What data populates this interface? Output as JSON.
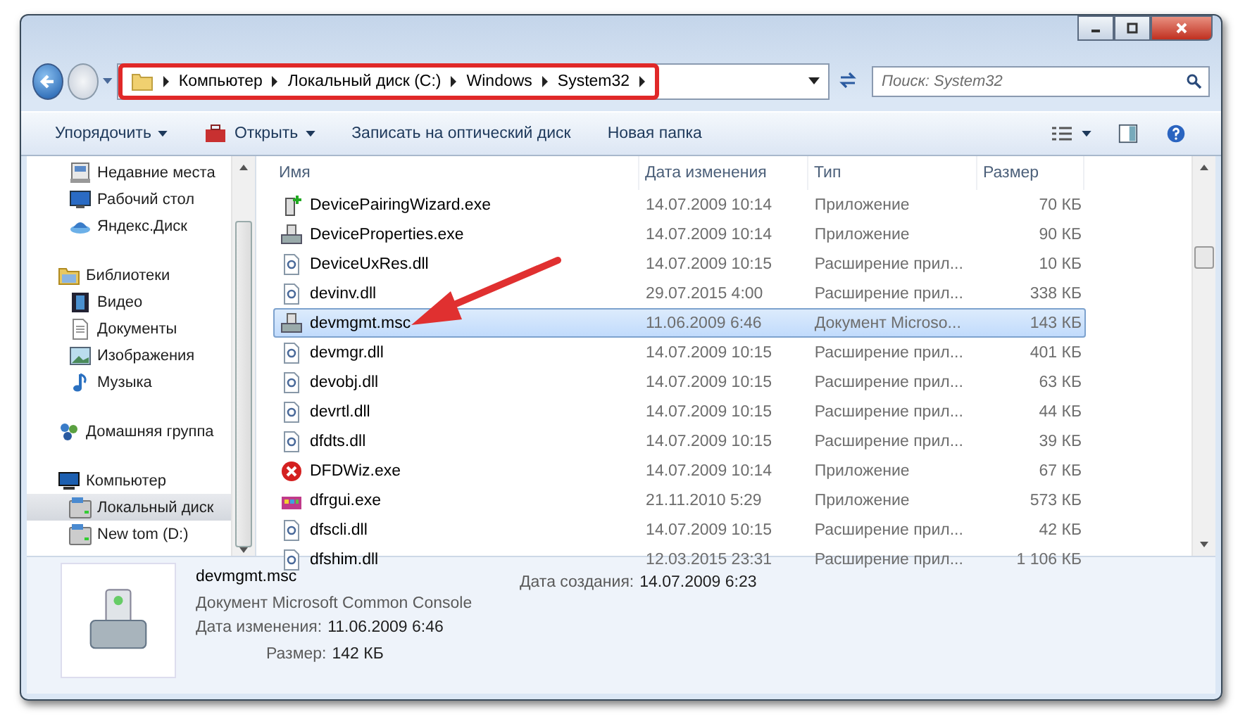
{
  "address_bar": {
    "crumbs": [
      "Компьютер",
      "Локальный диск (C:)",
      "Windows",
      "System32"
    ],
    "highlighted": true
  },
  "search": {
    "placeholder": "Поиск: System32"
  },
  "toolbar": {
    "buttons": [
      {
        "kind": "menu",
        "label": "Упорядочить"
      },
      {
        "kind": "open",
        "label": "Открыть"
      },
      {
        "kind": "plain",
        "label": "Записать на оптический диск"
      },
      {
        "kind": "plain",
        "label": "Новая папка"
      }
    ]
  },
  "sidebar": {
    "favorites": [
      {
        "kind": "recent",
        "label": "Недавние места",
        "selected": false
      },
      {
        "kind": "desktop",
        "label": "Рабочий стол",
        "selected": false
      },
      {
        "kind": "cloud",
        "label": "Яндекс.Диск",
        "selected": false
      }
    ],
    "tree": [
      {
        "kind": "library",
        "label": "Библиотеки",
        "selected": false,
        "children": [
          {
            "kind": "video",
            "label": "Видео",
            "selected": false
          },
          {
            "kind": "document",
            "label": "Документы",
            "selected": false
          },
          {
            "kind": "image",
            "label": "Изображения",
            "selected": false
          },
          {
            "kind": "music",
            "label": "Музыка",
            "selected": false
          }
        ]
      },
      {
        "kind": "homegroup",
        "label": "Домашняя группа",
        "selected": false
      },
      {
        "kind": "computer",
        "label": "Компьютер",
        "selected": false,
        "children": [
          {
            "kind": "drive",
            "label": "Локальный диск",
            "selected": true
          },
          {
            "kind": "drive",
            "label": "New tom (D:)",
            "selected": false
          }
        ]
      }
    ]
  },
  "table": {
    "columns": [
      "Имя",
      "Дата изменения",
      "Тип",
      "Размер"
    ],
    "rows": [
      {
        "kind": "wizard",
        "name": "DevicePairingWizard.exe",
        "date": "14.07.2009 10:14",
        "type": "Приложение",
        "size": "70 КБ",
        "selected": false
      },
      {
        "kind": "device",
        "name": "DeviceProperties.exe",
        "date": "14.07.2009 10:14",
        "type": "Приложение",
        "size": "90 КБ",
        "selected": false
      },
      {
        "kind": "dll",
        "name": "DeviceUxRes.dll",
        "date": "14.07.2009 10:15",
        "type": "Расширение прил...",
        "size": "10 КБ",
        "selected": false
      },
      {
        "kind": "dll",
        "name": "devinv.dll",
        "date": "29.07.2015 4:00",
        "type": "Расширение прил...",
        "size": "338 КБ",
        "selected": false
      },
      {
        "kind": "device",
        "name": "devmgmt.msc",
        "date": "11.06.2009 6:46",
        "type": "Документ Microso...",
        "size": "143 КБ",
        "selected": true
      },
      {
        "kind": "dll",
        "name": "devmgr.dll",
        "date": "14.07.2009 10:15",
        "type": "Расширение прил...",
        "size": "401 КБ",
        "selected": false
      },
      {
        "kind": "dll",
        "name": "devobj.dll",
        "date": "14.07.2009 10:15",
        "type": "Расширение прил...",
        "size": "63 КБ",
        "selected": false
      },
      {
        "kind": "dll",
        "name": "devrtl.dll",
        "date": "14.07.2009 10:15",
        "type": "Расширение прил...",
        "size": "44 КБ",
        "selected": false
      },
      {
        "kind": "dll",
        "name": "dfdts.dll",
        "date": "14.07.2009 10:15",
        "type": "Расширение прил...",
        "size": "39 КБ",
        "selected": false
      },
      {
        "kind": "error",
        "name": "DFDWiz.exe",
        "date": "14.07.2009 10:14",
        "type": "Приложение",
        "size": "67 КБ",
        "selected": false
      },
      {
        "kind": "defrag",
        "name": "dfrgui.exe",
        "date": "21.11.2010 5:29",
        "type": "Приложение",
        "size": "573 КБ",
        "selected": false
      },
      {
        "kind": "dll",
        "name": "dfscli.dll",
        "date": "14.07.2009 10:15",
        "type": "Расширение прил...",
        "size": "42 КБ",
        "selected": false
      },
      {
        "kind": "dll",
        "name": "dfshim.dll",
        "date": "12.03.2015 23:31",
        "type": "Расширение прил...",
        "size": "1 106 КБ",
        "selected": false
      }
    ]
  },
  "details": {
    "name": "devmgmt.msc",
    "type": "Документ Microsoft Common Console",
    "fields": [
      {
        "label": "Дата изменения:",
        "value": "11.06.2009 6:46"
      },
      {
        "label": "Размер:",
        "value": "142 КБ"
      }
    ],
    "created": {
      "label": "Дата создания:",
      "value": "14.07.2009 6:23"
    }
  },
  "annotation_arrow": true
}
